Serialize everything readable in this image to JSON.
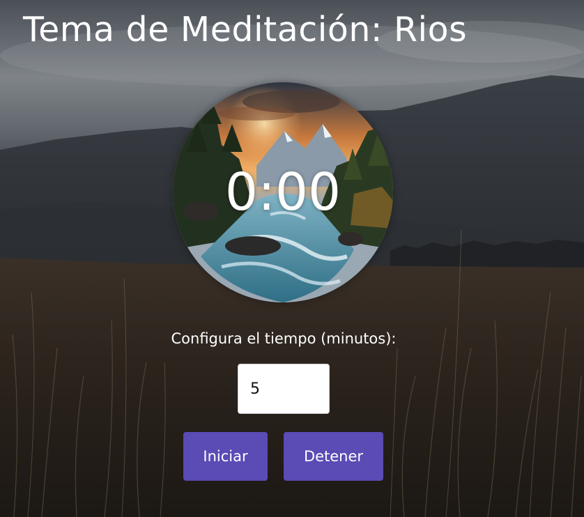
{
  "page": {
    "title": "Tema de Meditación: Rios"
  },
  "timer": {
    "display": "0:00",
    "image_icon": "river-landscape-image"
  },
  "config": {
    "label": "Configura el tiempo (minutos):",
    "minutes_value": "5"
  },
  "controls": {
    "start_label": "Iniciar",
    "stop_label": "Detener"
  },
  "colors": {
    "button": "#5a4bb5",
    "text": "#ffffff",
    "input_bg": "#ffffff"
  }
}
